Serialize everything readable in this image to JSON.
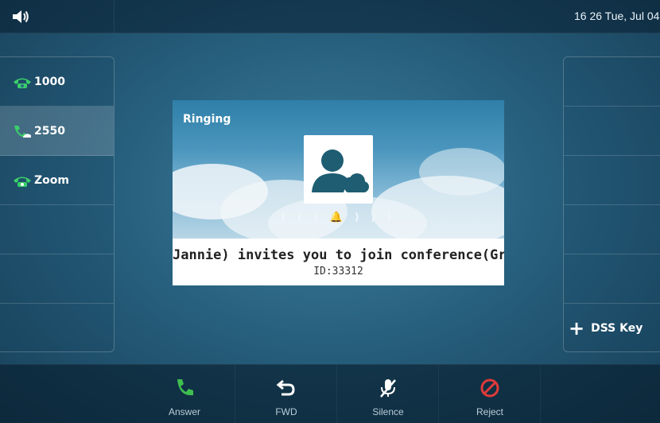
{
  "status_bar": {
    "volume_icon": "speaker-icon",
    "datetime": "16 26 Tue, Jul 04"
  },
  "lines": [
    {
      "label": "1000",
      "icon": "phone-registered-icon",
      "active": false
    },
    {
      "label": "2550",
      "icon": "phone-ringing-icon",
      "active": true
    },
    {
      "label": "Zoom",
      "icon": "phone-registered-icon",
      "active": false
    }
  ],
  "dss": {
    "add_label": "DSS Key"
  },
  "incoming": {
    "state": "Ringing",
    "message": "Jannie) invites you to join conference(Gr",
    "id_text": "ID:33312",
    "ring_indicator": "( ( ( 🔔 ) ) )"
  },
  "softkeys": [
    {
      "label": "Answer",
      "icon": "answer-phone-icon",
      "color": "#3fbf4f"
    },
    {
      "label": "FWD",
      "icon": "forward-icon",
      "color": "#ffffff"
    },
    {
      "label": "Silence",
      "icon": "mute-mic-icon",
      "color": "#ffffff"
    },
    {
      "label": "Reject",
      "icon": "reject-icon",
      "color": "#e03a3a"
    }
  ]
}
